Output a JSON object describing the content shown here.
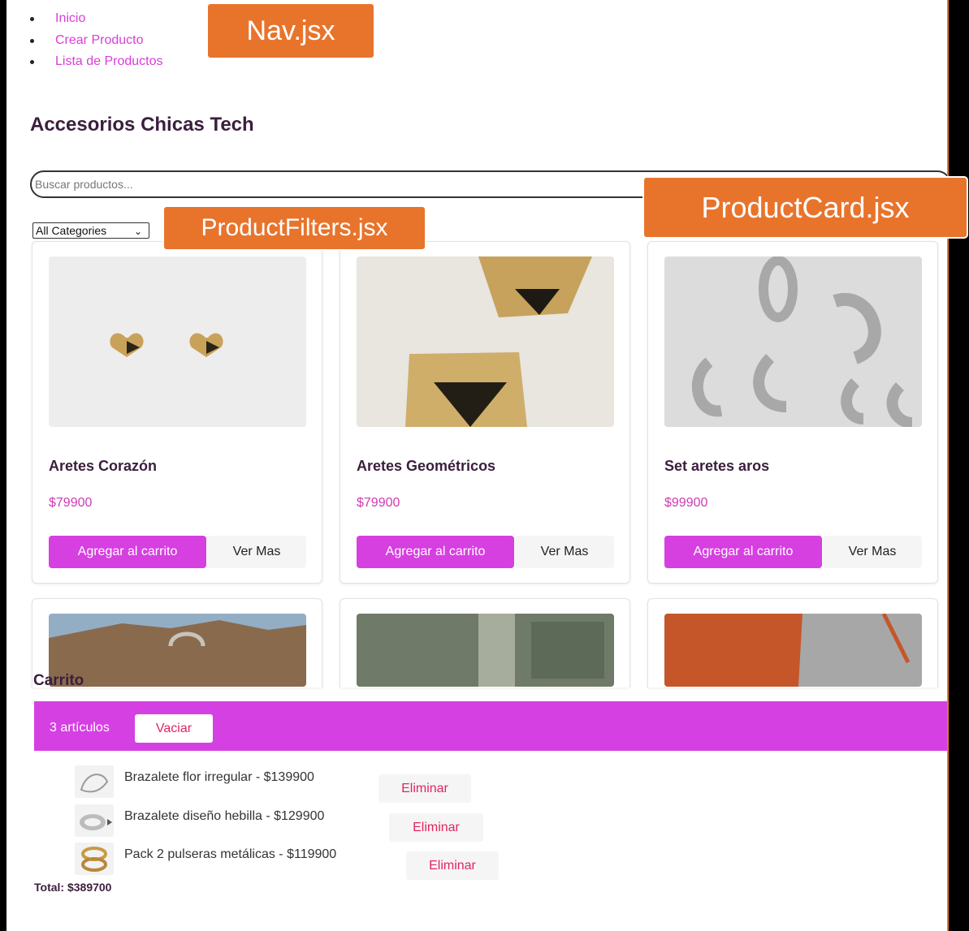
{
  "nav": {
    "items": [
      "Inicio",
      "Crear Producto",
      "Lista de Productos"
    ]
  },
  "store": {
    "title": "Accesorios Chicas Tech"
  },
  "search": {
    "placeholder": "Buscar productos..."
  },
  "filters": {
    "category_selected": "All Categories"
  },
  "products": [
    {
      "name": "Aretes Corazón",
      "price": "$79900",
      "add_label": "Agregar al carrito",
      "more_label": "Ver Mas",
      "image": "gold-heart-earrings"
    },
    {
      "name": "Aretes Geométricos",
      "price": "$79900",
      "add_label": "Agregar al carrito",
      "more_label": "Ver Mas",
      "image": "gold-geometric-earrings"
    },
    {
      "name": "Set aretes aros",
      "price": "$99900",
      "add_label": "Agregar al carrito",
      "more_label": "Ver Mas",
      "image": "silver-hoop-earrings"
    }
  ],
  "more_products": [
    {
      "image": "brown-bag-on-rocks"
    },
    {
      "image": "olive-green-bag"
    },
    {
      "image": "orange-bag"
    }
  ],
  "cart": {
    "title": "Carrito",
    "count_label": "3 artículos",
    "empty_label": "Vaciar",
    "items": [
      {
        "text": "Brazalete flor irregular - $139900",
        "remove_label": "Eliminar",
        "image": "silver-flower-bracelet"
      },
      {
        "text": "Brazalete diseño hebilla - $129900",
        "remove_label": "Eliminar",
        "image": "silver-buckle-bracelet"
      },
      {
        "text": "Pack 2 pulseras metálicas - $119900",
        "remove_label": "Eliminar",
        "image": "gold-bracelet-pack"
      }
    ],
    "total_label": "Total: $389700"
  },
  "annotations": {
    "nav": "Nav.jsx",
    "filters": "ProductFilters.jsx",
    "card": "ProductCard.jsx"
  },
  "colors": {
    "accent": "#d63fe0",
    "annotation": "#e8742c",
    "title": "#3b1e3d",
    "price": "#d03ab3",
    "danger": "#e0265f"
  }
}
